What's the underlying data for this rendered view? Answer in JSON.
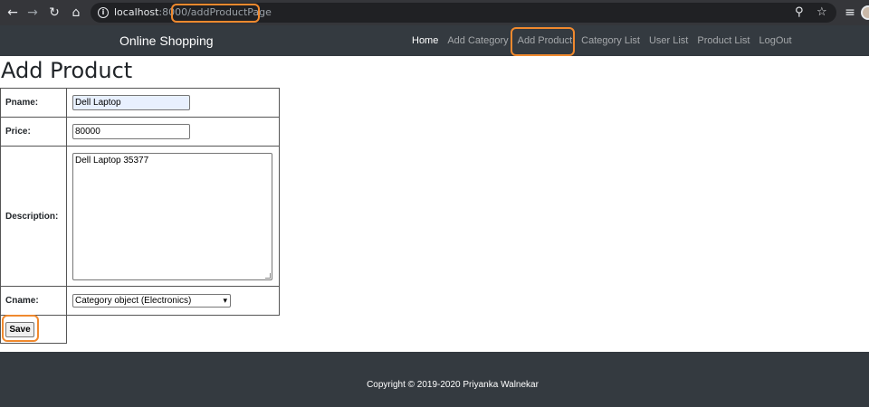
{
  "browser": {
    "url_host": "localhost",
    "url_port": ":8000",
    "url_path": "/addProductPage"
  },
  "navbar": {
    "brand": "Online Shopping",
    "links": [
      {
        "label": "Home",
        "active": true
      },
      {
        "label": "Add Category",
        "active": false
      },
      {
        "label": "Add Product",
        "active": false
      },
      {
        "label": "Category List",
        "active": false
      },
      {
        "label": "User List",
        "active": false
      },
      {
        "label": "Product List",
        "active": false
      },
      {
        "label": "LogOut",
        "active": false
      }
    ]
  },
  "page": {
    "title": "Add Product"
  },
  "form": {
    "pname_label": "Pname:",
    "pname_value": "Dell Laptop",
    "price_label": "Price:",
    "price_value": "80000",
    "description_label": "Description:",
    "description_value": "Dell Laptop 35377",
    "cname_label": "Cname:",
    "cname_selected": "Category object (Electronics)",
    "save_label": "Save"
  },
  "footer": {
    "text": "Copyright © 2019-2020 Priyanka Walnekar"
  },
  "colors": {
    "navbar_bg": "#343a40",
    "browser_bg": "#35363a",
    "highlight": "#f0892e"
  }
}
